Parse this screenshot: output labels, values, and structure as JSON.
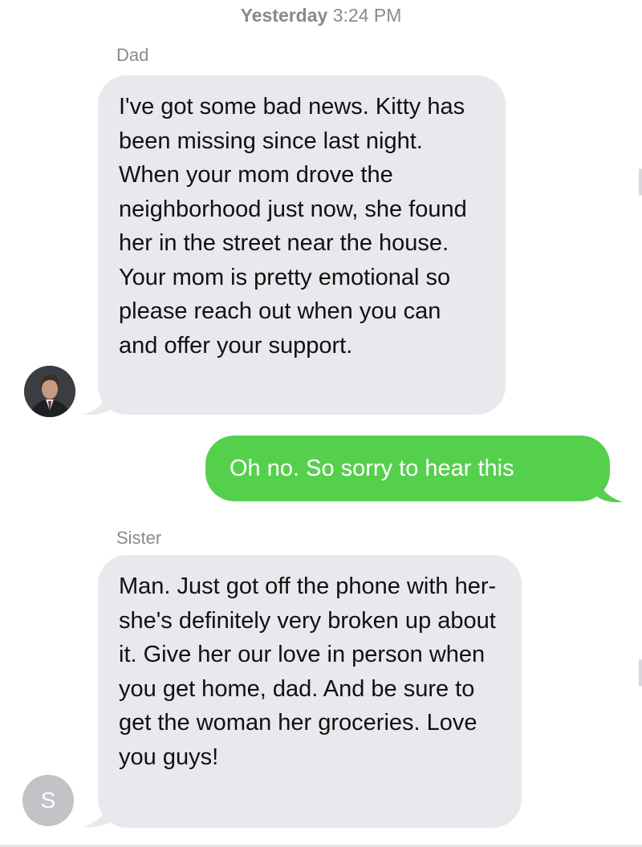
{
  "thread": {
    "timestamp_day": "Yesterday",
    "timestamp_time": "3:24 PM",
    "messages": [
      {
        "sender": "Dad",
        "direction": "received",
        "text": "I've got some bad news. Kitty has been missing since last night. When your mom drove the neighborhood just now, she found her in the street near the house. Your mom is pretty emotional so please reach out when you can and offer your support."
      },
      {
        "direction": "sent",
        "text": "Oh no. So sorry to hear this"
      },
      {
        "sender": "Sister",
        "direction": "received",
        "text": "Man. Just got off the phone with her-she's definitely very broken up about it. Give her our love in person when you get home, dad. And be sure to get the woman her groceries. Love you guys!",
        "avatar_initial": "S"
      }
    ]
  },
  "colors": {
    "received_bubble": "#e8e8ed",
    "sent_bubble": "#55d04d",
    "meta_text": "#8a8a8e"
  }
}
